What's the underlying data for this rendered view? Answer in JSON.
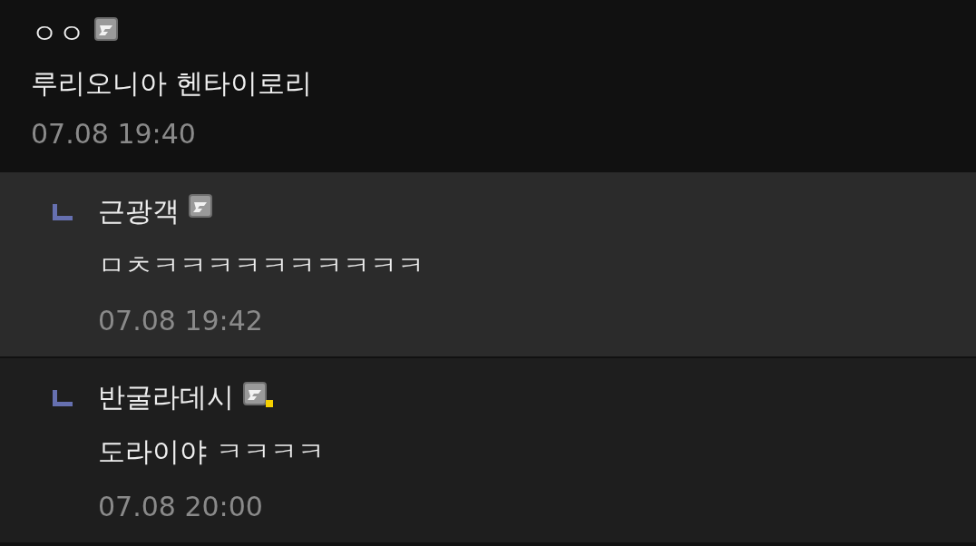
{
  "comment": {
    "author": "ㅇㅇ",
    "badge": {
      "kind": "fixed"
    },
    "text": "루리오니아 헨타이로리",
    "time": "07.08 19:40"
  },
  "replies": [
    {
      "author": "근광객",
      "badge": {
        "kind": "fixed"
      },
      "text": "ㅁㅊㅋㅋㅋㅋㅋㅋㅋㅋㅋㅋ",
      "time": "07.08 19:42",
      "highlighted": true
    },
    {
      "author": "반굴라데시",
      "badge": {
        "kind": "semi"
      },
      "text": "도라이야 ㅋㅋㅋㅋ",
      "time": "07.08 20:00",
      "highlighted": false
    }
  ]
}
